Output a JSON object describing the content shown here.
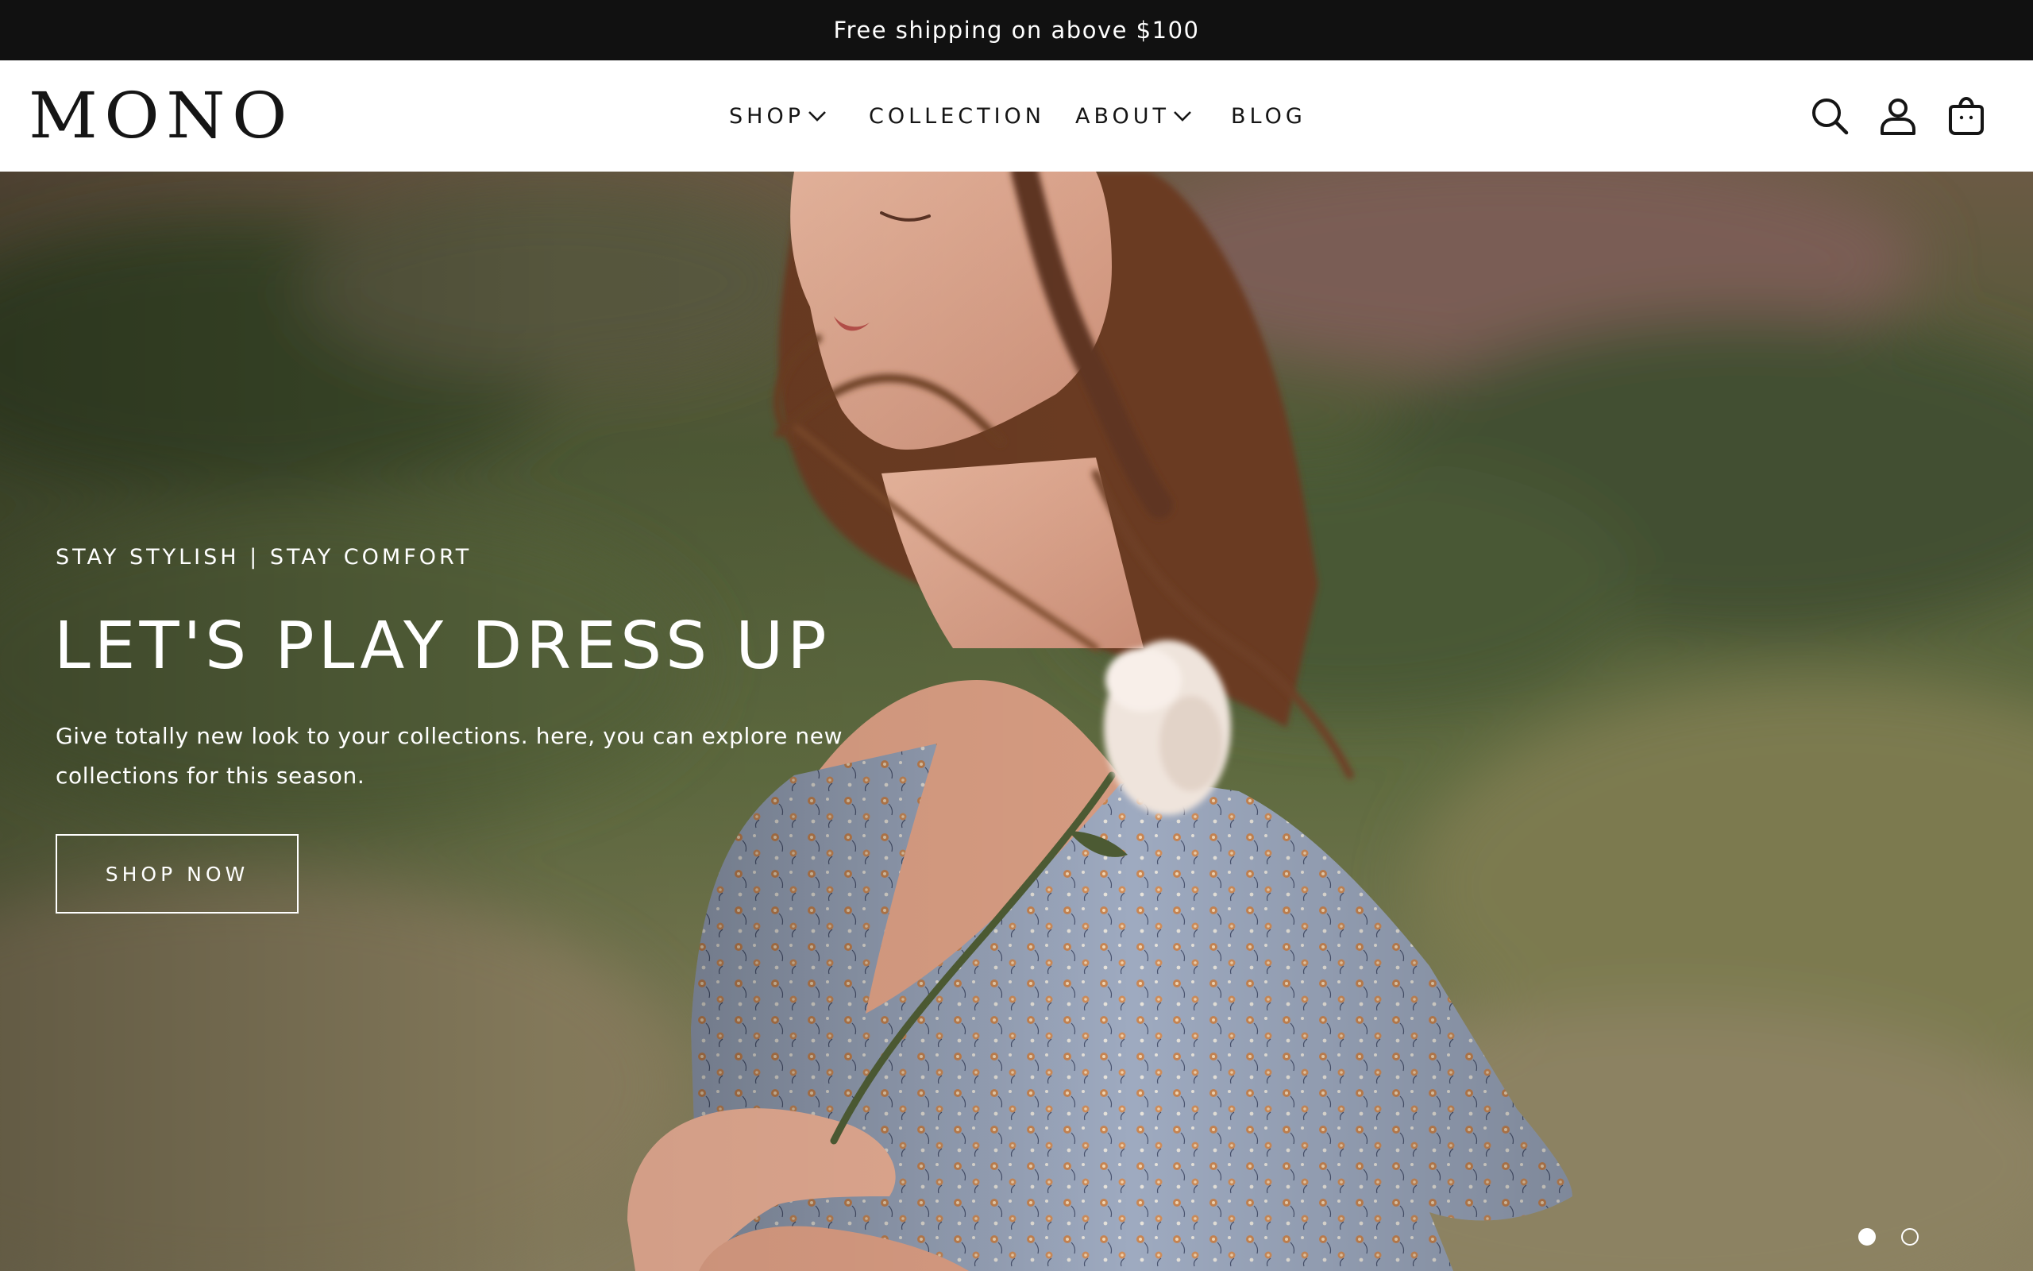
{
  "announcement": {
    "text": "Free shipping on above $100"
  },
  "header": {
    "logo": "MONO",
    "nav": [
      {
        "label": "SHOP",
        "has_dropdown": true
      },
      {
        "label": "COLLECTION",
        "has_dropdown": false
      },
      {
        "label": "ABOUT",
        "has_dropdown": true
      },
      {
        "label": "BLOG",
        "has_dropdown": false
      }
    ],
    "icons": [
      "search-icon",
      "account-icon",
      "cart-icon"
    ]
  },
  "hero": {
    "eyebrow": "STAY STYLISH | STAY COMFORT",
    "title": "LET'S PLAY DRESS UP",
    "description": "Give totally new look to your collections. here, you can explore new collections for this season.",
    "cta": "SHOP NOW",
    "slides": {
      "count": 2,
      "active": 1
    }
  },
  "colors": {
    "announcement_bg": "#111111",
    "text_dark": "#151515",
    "hero_text": "#ffffff"
  }
}
